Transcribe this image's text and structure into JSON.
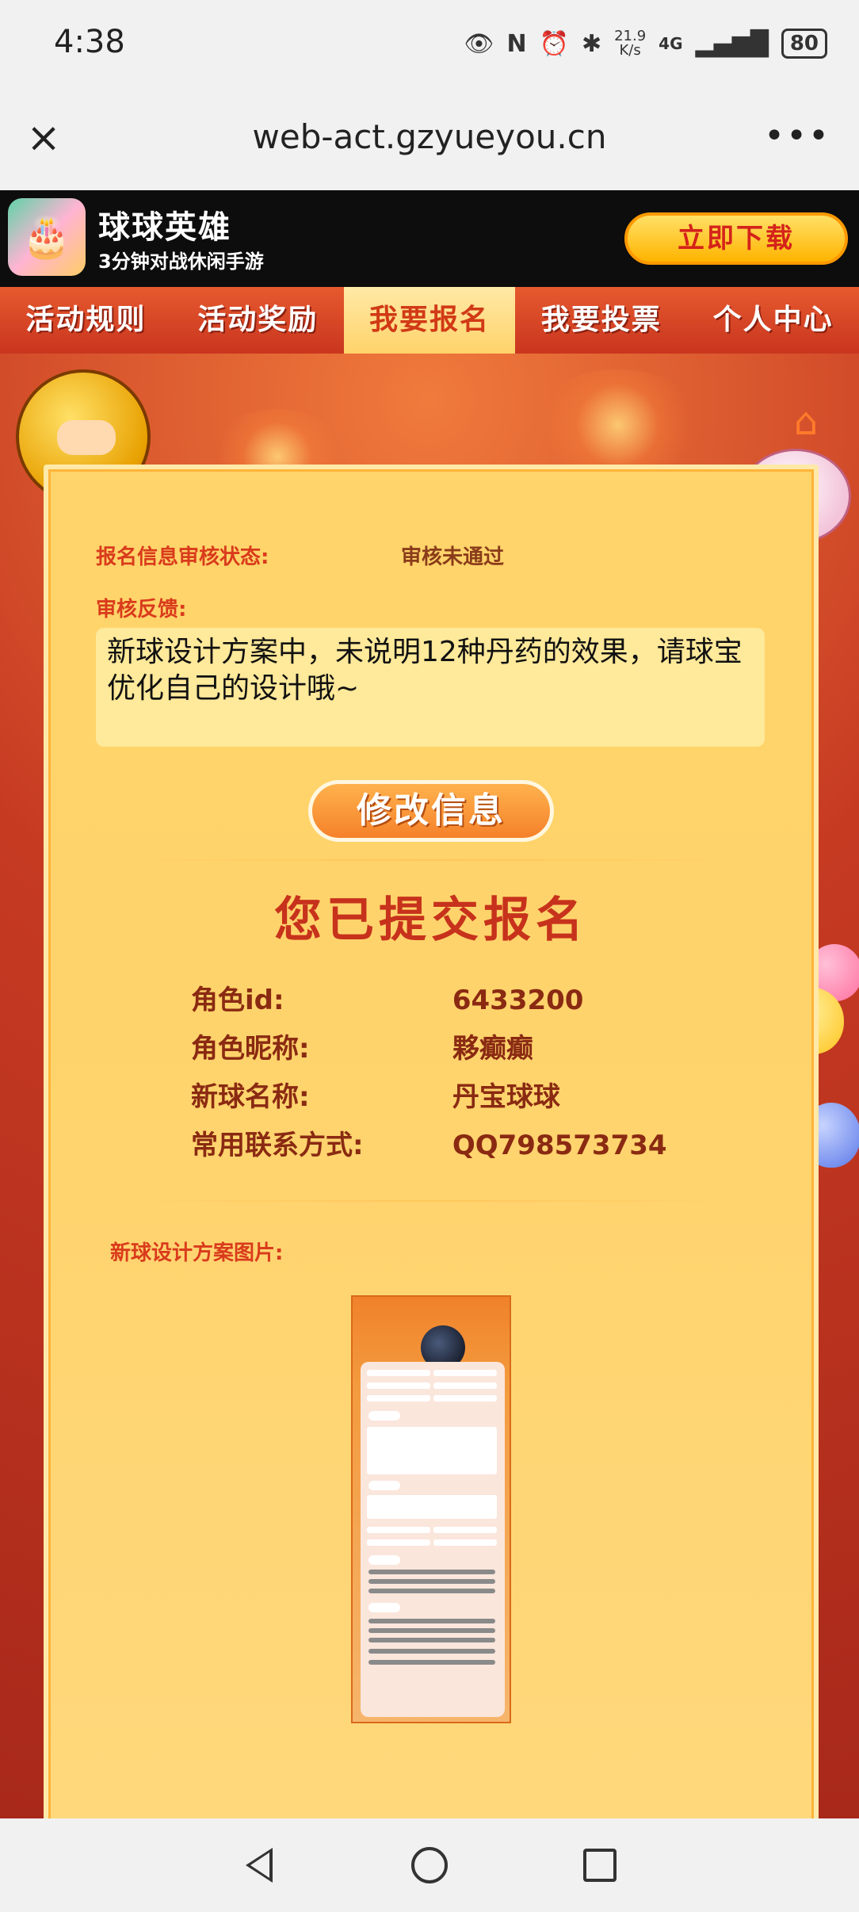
{
  "status_bar": {
    "time": "4:38",
    "net_speed_value": "21.9",
    "net_speed_unit": "K/s",
    "network": "4G",
    "battery": "80",
    "icons": [
      "eye-icon",
      "nfc-icon",
      "alarm-icon",
      "bluetooth-icon",
      "signal-icon"
    ]
  },
  "browser": {
    "close_label": "×",
    "url": "web-act.gzyueyou.cn",
    "more_label": "•••"
  },
  "banner": {
    "game_name": "球球英雄",
    "slogan": "3分钟对战休闲手游",
    "download_label": "立即下载"
  },
  "nav": {
    "tabs": [
      {
        "label": "活动规则",
        "active": false
      },
      {
        "label": "活动奖励",
        "active": false
      },
      {
        "label": "我要报名",
        "active": true
      },
      {
        "label": "我要投票",
        "active": false
      },
      {
        "label": "个人中心",
        "active": false
      }
    ]
  },
  "review": {
    "status_label": "报名信息审核状态:",
    "status_value": "审核未通过",
    "feedback_label": "审核反馈:",
    "feedback_text": "新球设计方案中，未说明12种丹药的效果，请球宝优化自己的设计哦~",
    "modify_label": "修改信息"
  },
  "submission": {
    "title": "您已提交报名",
    "fields": [
      {
        "label": "角色id:",
        "value": "6433200"
      },
      {
        "label": "角色昵称:",
        "value": "夥癫癫"
      },
      {
        "label": "新球名称:",
        "value": "丹宝球球"
      },
      {
        "label": "常用联系方式:",
        "value": "QQ798573734"
      }
    ],
    "design_label": "新球设计方案图片:"
  },
  "colors": {
    "accent_red": "#d93b1c",
    "panel_yellow": "#ffd46a",
    "nav_red": "#c9351f"
  }
}
